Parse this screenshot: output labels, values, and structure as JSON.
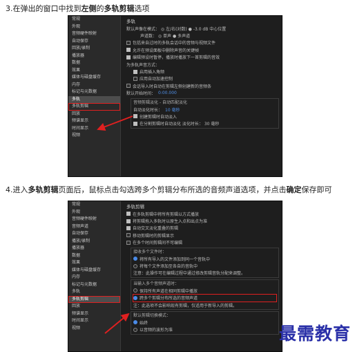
{
  "steps": [
    {
      "pre": "3.在弹出的窗口中找到",
      "b1": "左侧",
      "mid": "的",
      "b2": "多轨剪辑",
      "post": "选项"
    },
    {
      "pre": "4.进入",
      "b1": "多轨剪辑",
      "mid": "页面后，鼠标点击勾选跨多个剪辑分布所选的音频声道选项，并点击",
      "b2": "确定",
      "post": "保存即可"
    }
  ],
  "shot1": {
    "nav": [
      "常规",
      "外观",
      "音频硬件映射",
      "自动保存",
      "回放/录制",
      "播放器",
      "数据",
      "效果",
      "媒体与磁盘缓存",
      "内存",
      "标记与元数据",
      "多轨",
      "多轨剪辑",
      "回放",
      "频谱显示",
      "时间显示",
      "视频"
    ],
    "selected_index": 11,
    "highlight_index": 12,
    "title": "多轨",
    "rows": [
      {
        "kind": "text",
        "text": "默认声像在模式：  ◎ 左/右(对数)  ● -3.0 dB 中心位置"
      },
      {
        "kind": "text",
        "text": "声道数：  ◎ 单声    ● 多声道",
        "indent": 2
      },
      {
        "kind": "check",
        "on": false,
        "text": "包括来自过时的多轨会话中的音频与视频文件"
      },
      {
        "kind": "check",
        "on": true,
        "text": "允许在预设面板中删除声音的关键帧"
      },
      {
        "kind": "check",
        "on": true,
        "text": "编辑预设时暂停，播放时播放下一首剪辑的音效"
      },
      {
        "kind": "text",
        "text": "为多轨声音方式："
      },
      {
        "kind": "check",
        "on": true,
        "text": "启用插入角频",
        "indent": 1
      },
      {
        "kind": "check",
        "on": false,
        "text": "应用自动加速控制",
        "indent": 1
      },
      {
        "kind": "check",
        "on": false,
        "text": "会话导入时自动在剪辑左侧创建新的音频条"
      },
      {
        "kind": "value",
        "text": "默认开始时间：",
        "value": "0:00.000"
      }
    ],
    "group_title": "音频剪辑淡化 - 自动匹配淡化",
    "group_rows": [
      {
        "kind": "value",
        "text": "自动淡化时长：",
        "value": "10 毫秒"
      },
      {
        "kind": "check",
        "on": true,
        "text": "创建剪辑时自动淡入"
      },
      {
        "kind": "check",
        "on": true,
        "text": "在分割剪辑时自动淡化      淡化时长：   30 毫秒"
      }
    ]
  },
  "shot2": {
    "nav": [
      "常规",
      "外观",
      "音频硬件映射",
      "音频声道",
      "自动保存",
      "播放/录制",
      "播放器",
      "数据",
      "效果",
      "媒体与磁盘缓存",
      "内存",
      "标记与元数据",
      "多轨",
      "多轨剪辑",
      "回放",
      "频谱显示",
      "时间显示",
      "视频"
    ],
    "selected_index": 13,
    "highlight_index": 13,
    "title": "多轨剪辑",
    "rows": [
      {
        "kind": "check",
        "on": true,
        "text": "在多轨剪辑中将所有剪辑以方式播放"
      },
      {
        "kind": "check",
        "on": true,
        "text": "将剪辑拖入多轨时以原生入点和出点为准"
      },
      {
        "kind": "check",
        "on": true,
        "text": "自动交叉淡化重叠的剪辑"
      },
      {
        "kind": "check",
        "on": false,
        "text": "移动剪辑时的剪辑显示"
      },
      {
        "kind": "check",
        "on": false,
        "text": "在多个时间剪辑间不可编辑"
      }
    ],
    "group1_title": "接收多个文件时：",
    "group1_rows": [
      {
        "kind": "radio",
        "on": true,
        "text": "将所有导入的文件添加到同一个音轨中"
      },
      {
        "kind": "radio",
        "on": false,
        "text": "将每个文件添加至各自的音轨中"
      },
      {
        "kind": "text",
        "text": "注意：此操作可在编辑过程中通过修改剪辑音轨分配来调整。"
      }
    ],
    "group2_title": "当输入多个音频声道时：",
    "group2_rows": [
      {
        "kind": "radio",
        "on": false,
        "text": "保持所有声道在相同剪辑中播放"
      },
      {
        "kind": "radio",
        "on": true,
        "text": "跨多个剪辑分布所选的音频声道",
        "highlight": true
      },
      {
        "kind": "text",
        "text": "注：此选项不会影响现有剪辑，仅适用于新导入的剪辑。"
      }
    ],
    "group3_title": "默认剪辑切换模式：",
    "group3_rows": [
      {
        "kind": "radio",
        "on": true,
        "text": "始终"
      },
      {
        "kind": "radio",
        "on": false,
        "text": "以音频的波形为准"
      }
    ]
  },
  "watermark": "最需教育",
  "colors": {
    "highlight": "#e02020",
    "accent": "#4f8fe6",
    "watermark": "#2a30a8"
  }
}
